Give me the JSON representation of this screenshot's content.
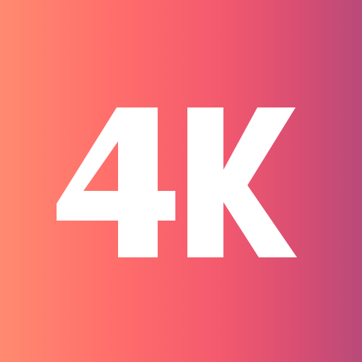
{
  "badge": {
    "label": "4K",
    "text_color": "#FFFFFF",
    "background": {
      "gradient_direction": "left-to-right",
      "colors": [
        "#FF8A70",
        "#FF6F6B",
        "#F45A6E",
        "#D94E72",
        "#B84A7A"
      ]
    }
  }
}
